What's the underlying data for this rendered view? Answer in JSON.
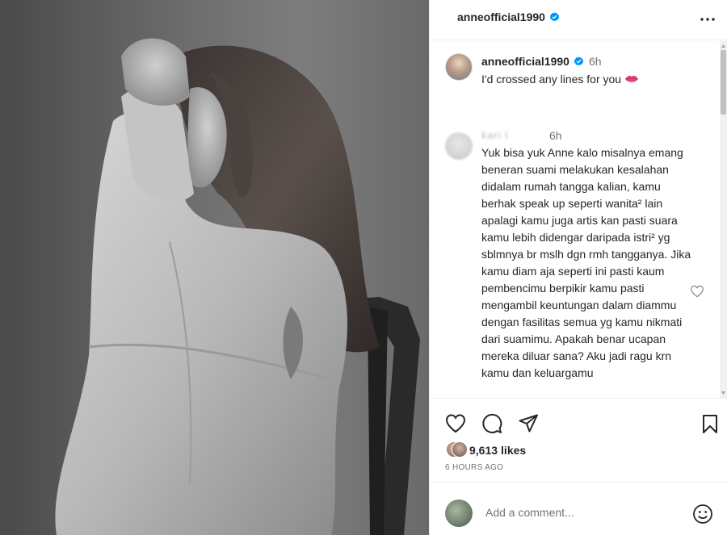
{
  "post": {
    "username": "anneofficial1990",
    "verified_icon": "verified-badge-icon",
    "more_icon": "more-options-icon"
  },
  "caption": {
    "username": "anneofficial1990",
    "time": "6h",
    "text": "I'd crossed any lines for you",
    "emoji_icon": "lips-emoji-icon"
  },
  "comment": {
    "username": "kari   l",
    "time": "6h",
    "text": "Yuk bisa yuk Anne kalo misalnya emang beneran suami melakukan kesalahan didalam rumah tangga kalian, kamu berhak speak up seperti wanita² lain apalagi kamu juga artis kan pasti suara kamu lebih didengar daripada istri² yg sblmnya br mslh dgn rmh tangganya. Jika kamu diam aja seperti ini pasti kaum pembencimu berpikir kamu pasti mengambil keuntungan dalam diammu dengan fasilitas semua yg kamu nikmati dari suamimu. Apakah benar ucapan mereka diluar sana? Aku jadi ragu krn kamu dan keluargamu",
    "like_icon": "heart-outline-icon"
  },
  "actions": {
    "like_icon": "heart-icon",
    "comment_icon": "comment-icon",
    "share_icon": "share-icon",
    "save_icon": "bookmark-icon",
    "likes_count": "9,613",
    "likes_label": "likes",
    "time_ago": "6 HOURS AGO"
  },
  "add_comment": {
    "placeholder": "Add a comment...",
    "emoji_icon": "smiley-icon"
  },
  "colors": {
    "verified": "#0095f6",
    "text": "#262626",
    "muted": "#737373",
    "divider": "#efefef"
  }
}
